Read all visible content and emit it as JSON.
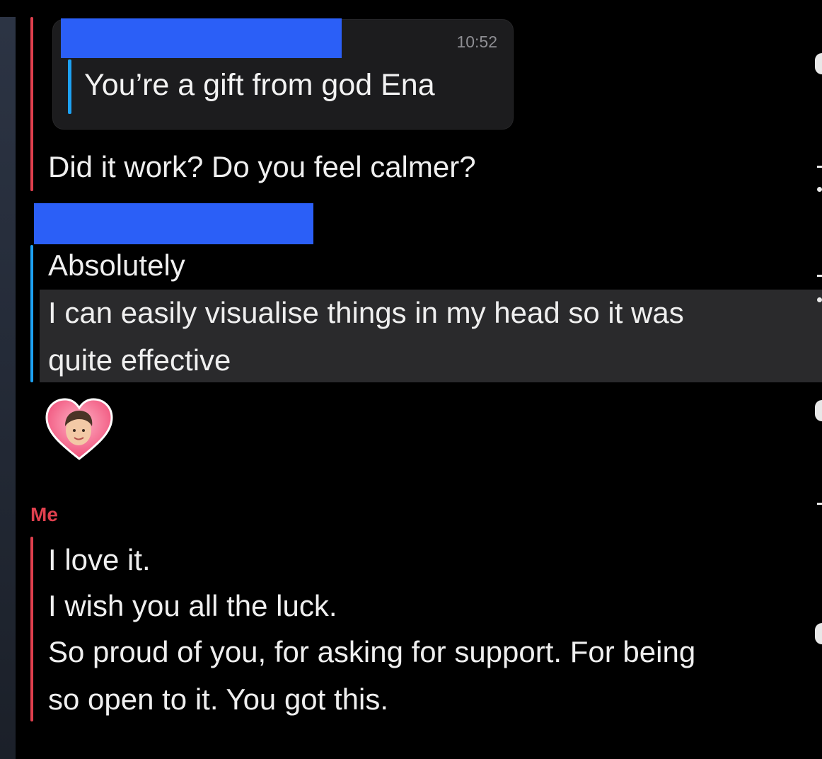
{
  "quoted_message": {
    "timestamp": "10:52",
    "text": "You’re a gift from god Ena"
  },
  "messages": [
    {
      "sender": "",
      "text": "Did it work? Do you feel calmer?"
    },
    {
      "sender": "",
      "lines": [
        "Absolutely",
        "I can easily visualise things in my head so it was",
        "quite effective"
      ]
    },
    {
      "sender": "",
      "reaction": "heart-bitmoji-icon"
    },
    {
      "sender": "Me",
      "lines": [
        "I love it.",
        "I wish you all the luck.",
        "So proud of you, for asking for support. For being",
        "so open to it. You got this."
      ]
    }
  ],
  "colors": {
    "background": "#121212",
    "me_accent": "#e0404e",
    "other_accent": "#1da1f2",
    "redaction": "#2b5ff7",
    "highlight": "#2a2a2c"
  }
}
